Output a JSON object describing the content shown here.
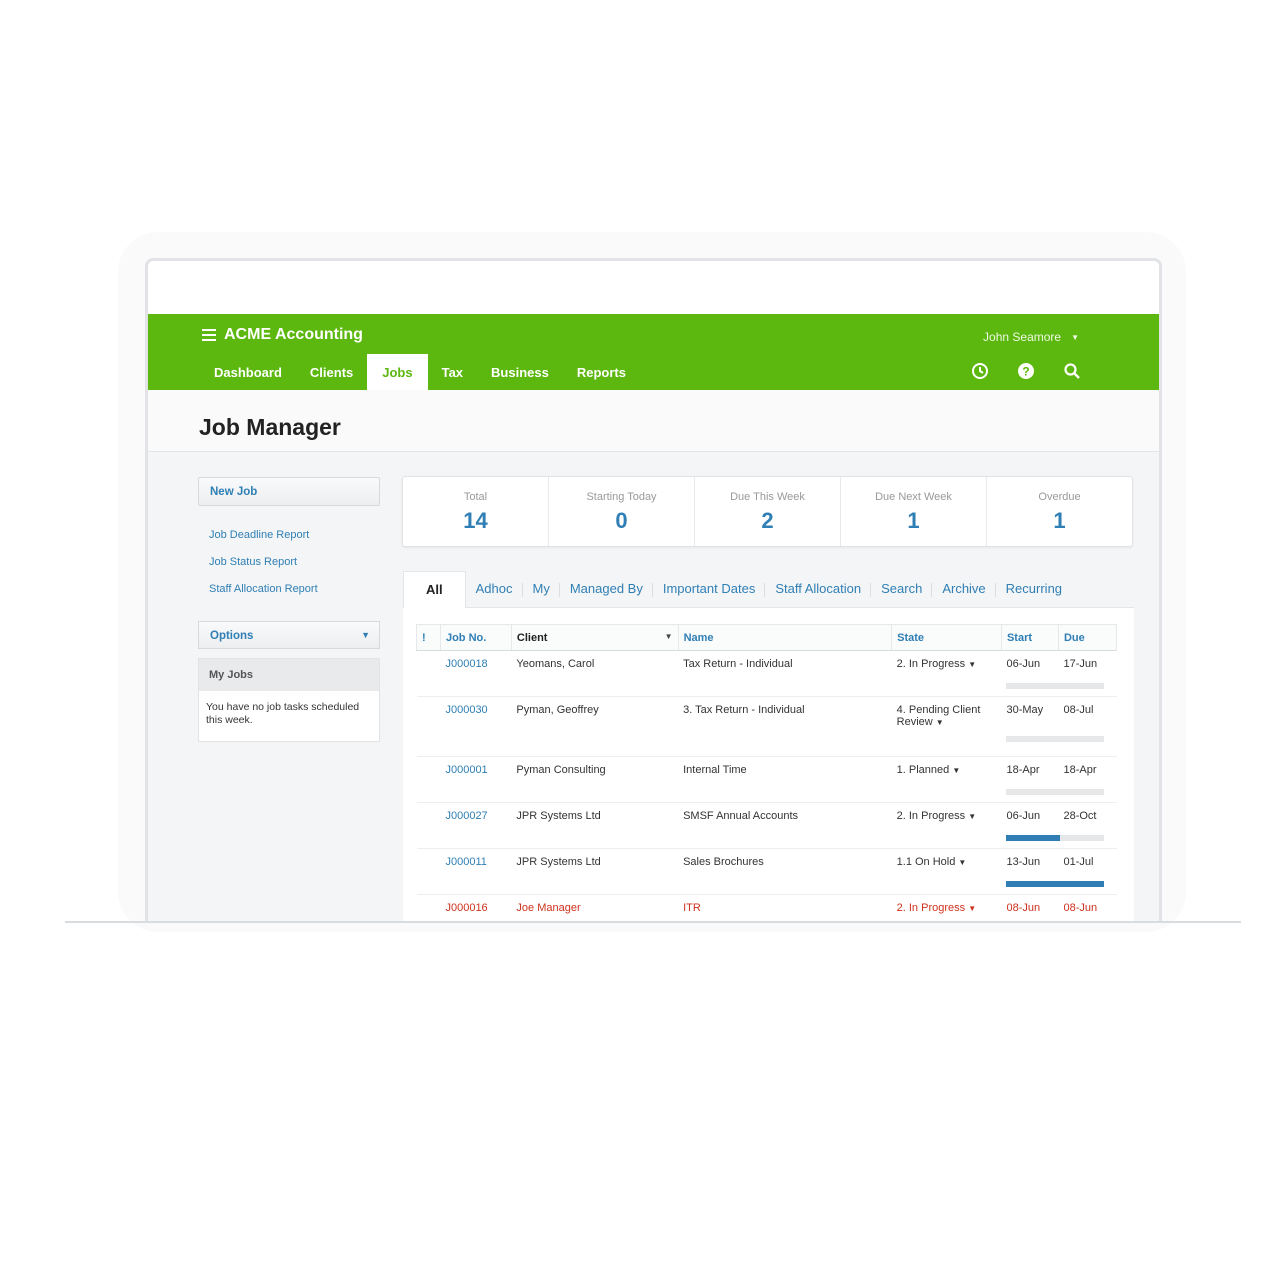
{
  "app": {
    "brand": "ACME Accounting",
    "user": "John Seamore"
  },
  "nav": [
    "Dashboard",
    "Clients",
    "Jobs",
    "Tax",
    "Business",
    "Reports"
  ],
  "page": {
    "title": "Job Manager"
  },
  "sidebar": {
    "new_job": "New Job",
    "reports": [
      "Job Deadline Report",
      "Job Status Report",
      "Staff Allocation Report"
    ],
    "options": "Options",
    "my_jobs_title": "My Jobs",
    "my_jobs_text": "You have no job tasks scheduled this week."
  },
  "stats": [
    {
      "label": "Total",
      "value": "14"
    },
    {
      "label": "Starting Today",
      "value": "0"
    },
    {
      "label": "Due This Week",
      "value": "2"
    },
    {
      "label": "Due Next Week",
      "value": "1"
    },
    {
      "label": "Overdue",
      "value": "1"
    }
  ],
  "tabs": [
    "All",
    "Adhoc",
    "My",
    "Managed By",
    "Important Dates",
    "Staff Allocation",
    "Search",
    "Archive",
    "Recurring"
  ],
  "table": {
    "headers": {
      "flag": "!",
      "job_no": "Job No.",
      "client": "Client",
      "name": "Name",
      "state": "State",
      "start": "Start",
      "due": "Due"
    },
    "rows": [
      {
        "job_no": "J000018",
        "client": "Yeomans, Carol",
        "name": "Tax Return - Individual",
        "state": "2. In Progress",
        "start": "06-Jun",
        "due": "17-Jun",
        "progress": 0
      },
      {
        "job_no": "J000030",
        "client": "Pyman, Geoffrey",
        "name": "3. Tax Return - Individual",
        "state": "4. Pending Client Review",
        "start": "30-May",
        "due": "08-Jul",
        "progress": 0
      },
      {
        "job_no": "J000001",
        "client": "Pyman Consulting",
        "name": "Internal Time",
        "state": "1. Planned",
        "start": "18-Apr",
        "due": "18-Apr",
        "progress": 0
      },
      {
        "job_no": "J000027",
        "client": "JPR Systems Ltd",
        "name": "SMSF Annual Accounts",
        "state": "2. In Progress",
        "start": "06-Jun",
        "due": "28-Oct",
        "progress": 0.55
      },
      {
        "job_no": "J000011",
        "client": "JPR Systems Ltd",
        "name": "Sales Brochures",
        "state": "1.1 On Hold",
        "start": "13-Jun",
        "due": "01-Jul",
        "progress": 1.0
      },
      {
        "job_no": "J000016",
        "client": "Joe Manager",
        "name": "ITR",
        "state": "2. In Progress",
        "start": "08-Jun",
        "due": "08-Jun",
        "overdue": true
      }
    ]
  },
  "colors": {
    "brand_green": "#5cb80f",
    "link_blue": "#2f7fb5",
    "overdue_red": "#d0311e"
  }
}
